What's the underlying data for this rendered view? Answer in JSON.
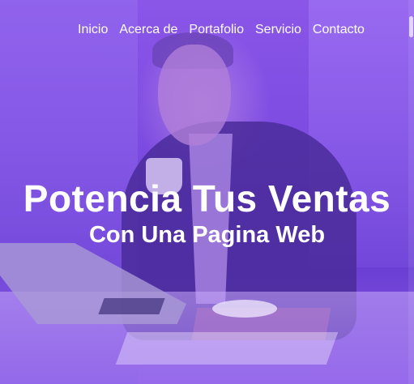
{
  "nav": {
    "items": [
      {
        "label": "Inicio"
      },
      {
        "label": "Acerca de"
      },
      {
        "label": "Portafolio"
      },
      {
        "label": "Servicio"
      },
      {
        "label": "Contacto"
      }
    ]
  },
  "hero": {
    "headline": "Potencia Tus Ventas",
    "subheadline": "Con Una Pagina Web",
    "overlay_color": "#7b4ae0",
    "background_image": "smiling-businessman-with-laptop-and-coffee"
  }
}
